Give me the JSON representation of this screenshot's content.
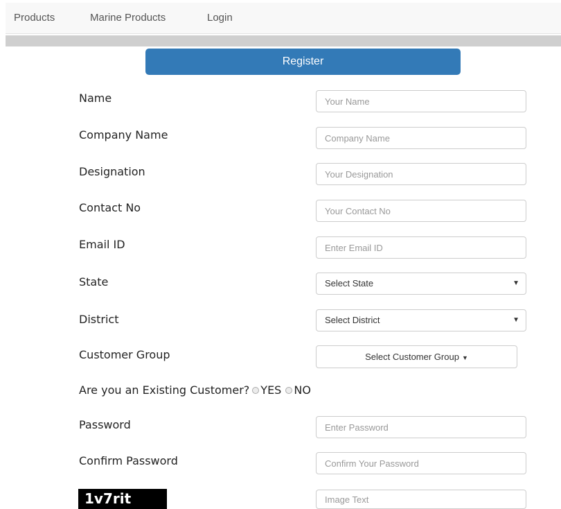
{
  "nav": {
    "items": [
      "Products",
      "Marine Products",
      "Login"
    ]
  },
  "register_title": "Register",
  "form": {
    "name": {
      "label": "Name",
      "placeholder": "Your Name"
    },
    "company": {
      "label": "Company Name",
      "placeholder": "Company Name"
    },
    "designation": {
      "label": "Designation",
      "placeholder": "Your Designation"
    },
    "contact": {
      "label": "Contact No",
      "placeholder": "Your Contact No"
    },
    "email": {
      "label": "Email ID",
      "placeholder": "Enter Email ID"
    },
    "state": {
      "label": "State",
      "selected": "Select State"
    },
    "district": {
      "label": "District",
      "selected": "Select District"
    },
    "customer_group": {
      "label": "Customer Group",
      "button": "Select Customer Group"
    },
    "existing": {
      "question": "Are you an Existing Customer?",
      "yes": "YES",
      "no": "NO"
    },
    "password": {
      "label": "Password",
      "placeholder": "Enter Password"
    },
    "confirm": {
      "label": "Confirm Password",
      "placeholder": "Confirm Your Password"
    },
    "captcha": {
      "code": "1v7rit",
      "placeholder": "Image Text"
    }
  },
  "icons": {
    "select_caret": "triangle-down-icon",
    "dropdown_caret": "caret-down-icon",
    "radio": "radio-circle-icon"
  },
  "colors": {
    "primary": "#337ab7",
    "navbar": "#f8f8f8",
    "graybar": "#cfcfcf"
  }
}
